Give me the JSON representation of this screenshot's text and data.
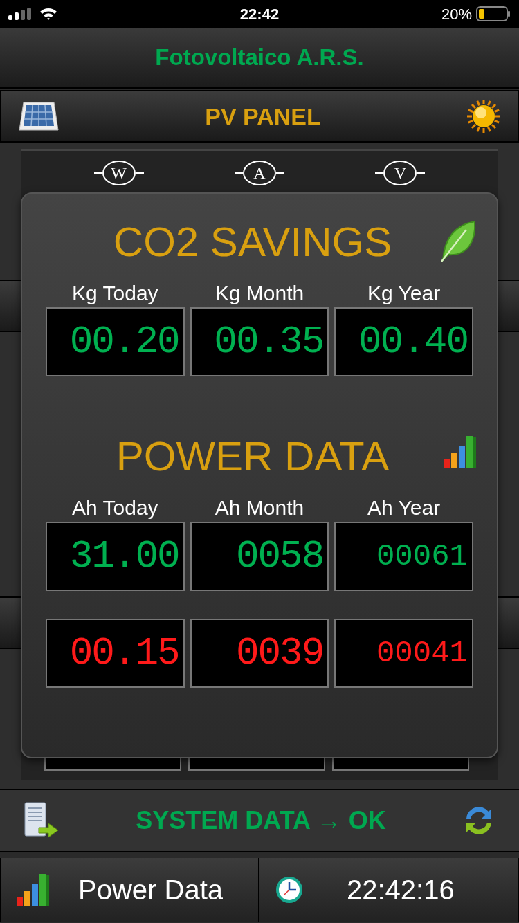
{
  "status_bar": {
    "time": "22:42",
    "battery": "20%"
  },
  "header": {
    "title": "Fotovoltaico A.R.S."
  },
  "section_bar": {
    "title": "PV PANEL"
  },
  "meters": [
    "W",
    "A",
    "V"
  ],
  "overlay": {
    "sections": [
      {
        "title": "CO2 SAVINGS",
        "kind": "leaf",
        "labels": [
          "Kg Today",
          "Kg Month",
          "Kg Year"
        ],
        "rows": [
          [
            {
              "value": "00.20",
              "color": "#00b050"
            },
            {
              "value": "00.35",
              "color": "#00b050"
            },
            {
              "value": "00.40",
              "color": "#00b050"
            }
          ]
        ]
      },
      {
        "title": "POWER DATA",
        "kind": "bars",
        "labels": [
          "Ah Today",
          "Ah Month",
          "Ah Year"
        ],
        "rows": [
          [
            {
              "value": "31.00",
              "color": "#00b050"
            },
            {
              "value": "0058",
              "color": "#00b050"
            },
            {
              "value": "00061",
              "color": "#00b050"
            }
          ],
          [
            {
              "value": "00.15",
              "color": "#ff1a1a"
            },
            {
              "value": "0039",
              "color": "#ff1a1a"
            },
            {
              "value": "00041",
              "color": "#ff1a1a"
            }
          ]
        ]
      }
    ]
  },
  "system_bar": {
    "text": "SYSTEM DATA → OK"
  },
  "tabs": [
    {
      "label": "Power Data",
      "kind": "bars"
    },
    {
      "label": "22:42:16",
      "kind": "clock"
    }
  ]
}
